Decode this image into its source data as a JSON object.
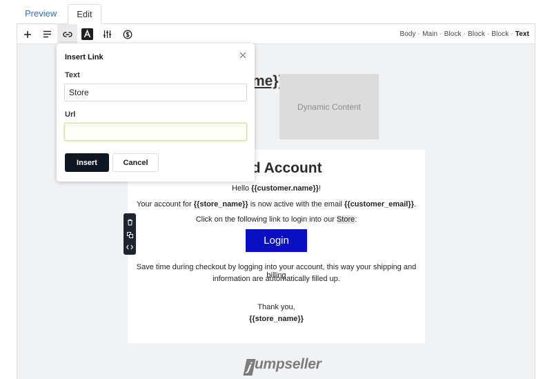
{
  "tabs": {
    "preview": "Preview",
    "edit": "Edit"
  },
  "toolbar": {
    "icons": [
      "plus-icon",
      "align-left-icon",
      "link-icon",
      "text-color-icon",
      "sliders-icon",
      "dollar-icon"
    ],
    "breadcrumbs": [
      "Body",
      "Main",
      "Block",
      "Block",
      "Block"
    ],
    "breadcrumb_current": "Text"
  },
  "canvas": {
    "name_fragment": "me}}",
    "dynamic_content_label": "Dynamic Content",
    "card": {
      "heading": "ated Account",
      "greeting_pre": "Hello ",
      "greeting_var": "{{customer.name}}",
      "greeting_post": "!",
      "account_pre": "Your account for ",
      "account_store_var": "{{store_name}}",
      "account_mid": " is now active with the email ",
      "account_email_var": "{{customer_email}}",
      "account_post": ".",
      "click_pre": "Click on the following link to login into our ",
      "click_store": "Store",
      "click_post": ":",
      "login_button": "Login",
      "save_time_line1": "Save time during checkout by logging into your account, this way your shipping and billing",
      "save_time_line2": "information are automatically filled up.",
      "thank_you": "Thank you,",
      "signature_var": "{{store_name}}"
    },
    "block_tools": [
      "trash-icon",
      "duplicate-icon",
      "code-icon"
    ],
    "footer_logo": "umpseller",
    "footer_logo_mark": "j"
  },
  "modal": {
    "title": "Insert Link",
    "text_label": "Text",
    "text_value": "Store",
    "url_label": "Url",
    "url_value": "",
    "insert_button": "Insert",
    "cancel_button": "Cancel"
  },
  "colors": {
    "accent_link": "#2f6fbf",
    "login_button": "#0a0fbf",
    "insert_button": "#0f1722",
    "focus_border": "#d7e0a4"
  }
}
